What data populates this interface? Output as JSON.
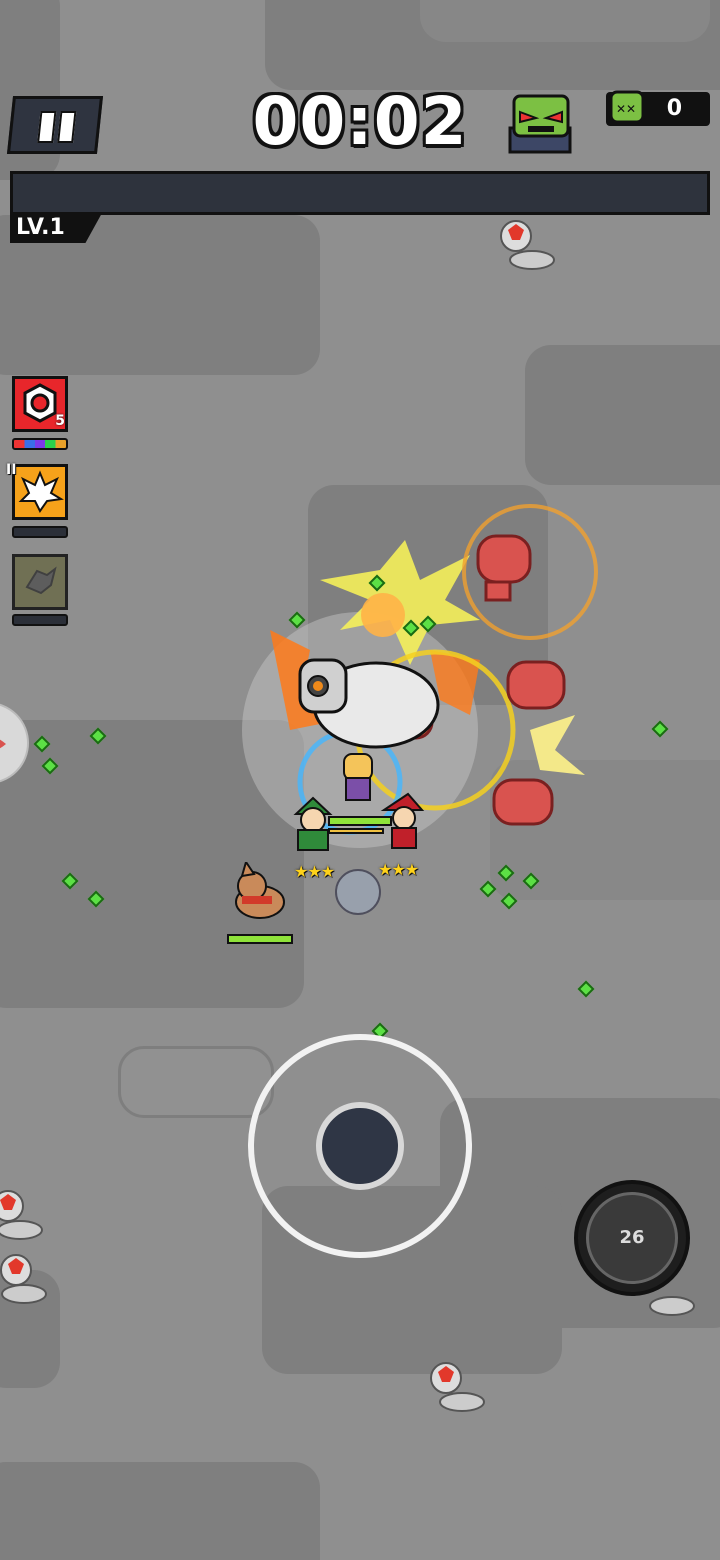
{
  "hud": {
    "timer": "00:02",
    "kill_count": "0",
    "level_label": "LV.1",
    "xp_progress": 0
  },
  "skills": [
    {
      "name": "gear-shield-skill",
      "badge": "5",
      "color": "#e8262b"
    },
    {
      "name": "explosion-skill",
      "badge": "II",
      "color": "#f6a21a"
    },
    {
      "name": "locked-skill",
      "badge": "",
      "color": "#6b6b4a"
    }
  ],
  "ultimate": {
    "cooldown": "26"
  },
  "icons": {
    "pause": "pause-icon",
    "boss": "boss-zombie-icon",
    "kills": "zombie-kill-icon",
    "joystick": "joystick",
    "ultimate": "bear-ultimate-icon"
  },
  "colors": {
    "accent_green": "#8fe33a",
    "hud_dark": "#2e333d",
    "gem_green": "#5ce045"
  }
}
